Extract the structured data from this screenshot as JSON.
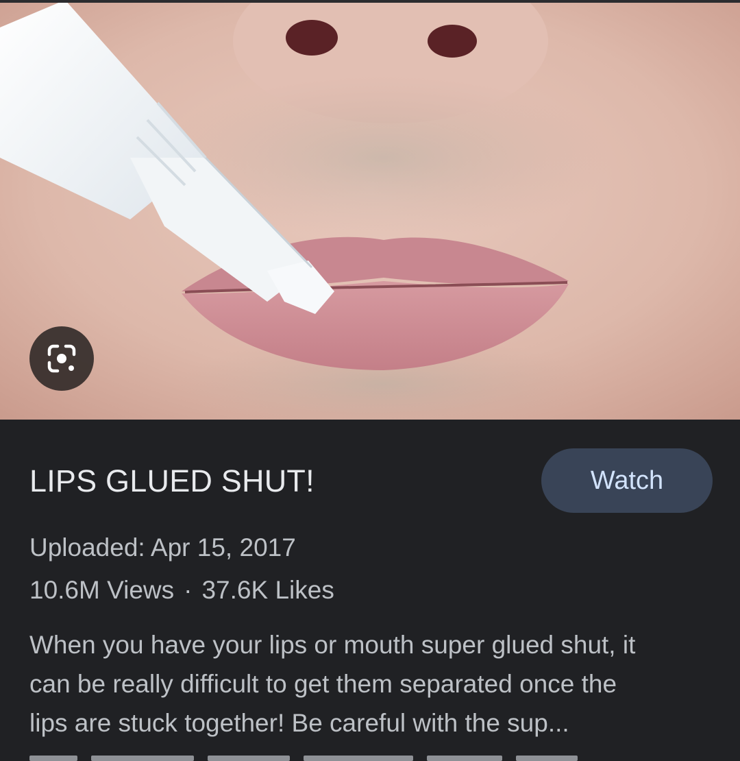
{
  "video": {
    "title": "LIPS GLUED SHUT!",
    "watch_label": "Watch",
    "uploaded": "Uploaded: Apr 15, 2017",
    "views": "10.6M Views",
    "separator": "·",
    "likes": "37.6K Likes",
    "description_lines": [
      "When you have your lips or mouth super glued shut, it",
      "can be really difficult to get them separated once the",
      "lips are stuck together! Be careful with the sup..."
    ]
  },
  "thumbnail": {
    "lens_icon": "google-lens-icon"
  },
  "colors": {
    "background": "#202124",
    "title": "#e8eaed",
    "meta": "#bdc1c6",
    "watch_button_bg": "#394457",
    "watch_button_text": "#d2e3fc"
  }
}
